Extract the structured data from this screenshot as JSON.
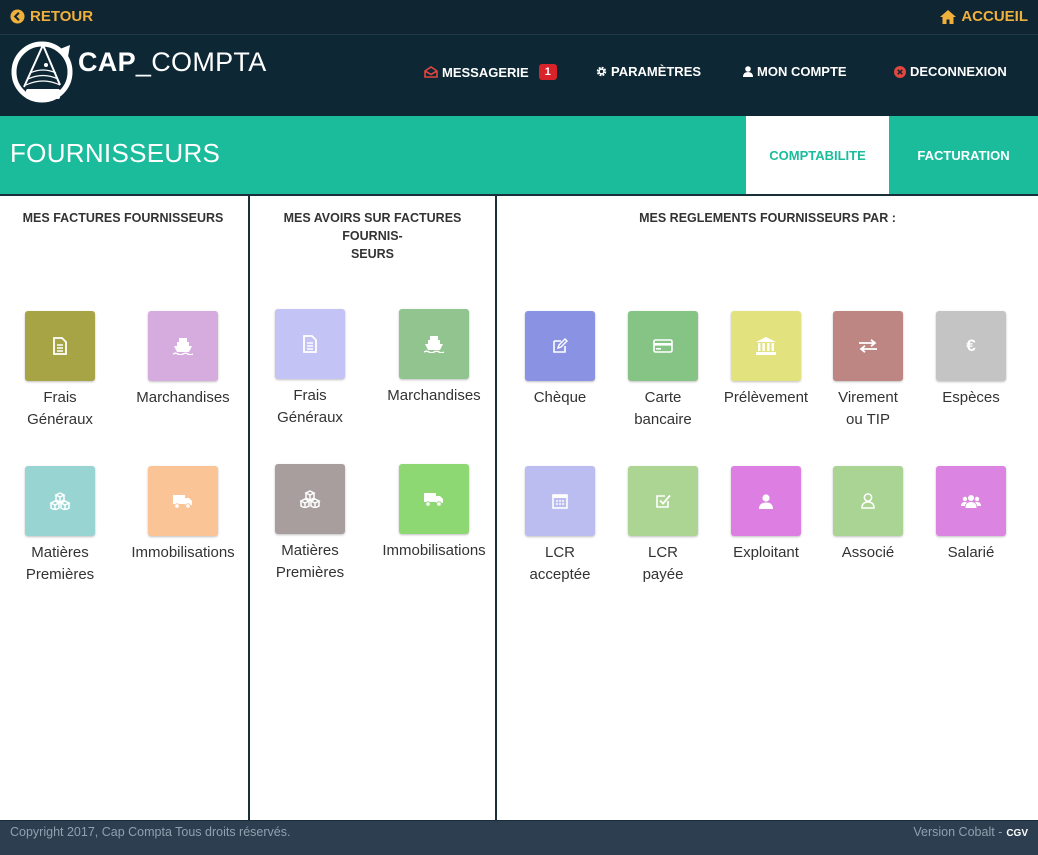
{
  "topbar": {
    "back_label": "RETOUR",
    "home_label": "ACCUEIL"
  },
  "header": {
    "brand_bold": "CAP",
    "brand_light": "_COMPTA",
    "nav": {
      "messagerie": "MESSAGERIE",
      "messagerie_count": "1",
      "parametres": "PARAMÈTRES",
      "mon_compte": "MON COMPTE",
      "deconnexion": "DECONNEXION"
    }
  },
  "band": {
    "title": "FOURNISSEURS",
    "tabs": [
      {
        "label": "COMPTABILITE"
      },
      {
        "label": "FACTURATION"
      }
    ]
  },
  "col1": {
    "title": "MES FACTURES FOURNISSEURS",
    "tiles": [
      {
        "line1": "Frais",
        "line2": "Généraux",
        "color": "#a6a444",
        "icon": "document-icon"
      },
      {
        "line1": "Marchandises",
        "line2": "",
        "color": "#d5acdd",
        "icon": "ship-icon"
      },
      {
        "line1": "Matières",
        "line2": "Premières",
        "color": "#97d4d2",
        "icon": "cubes-icon"
      },
      {
        "line1": "Immobilisations",
        "line2": "",
        "color": "#fbc497",
        "icon": "truck-icon"
      }
    ]
  },
  "col2": {
    "title_line1": "MES AVOIRS SUR FACTURES FOURNIS-",
    "title_line2": "SEURS",
    "tiles": [
      {
        "line1": "Frais",
        "line2": "Généraux",
        "color": "#c3c3f5",
        "icon": "document-icon"
      },
      {
        "line1": "Marchandises",
        "line2": "",
        "color": "#92c48f",
        "icon": "ship-icon"
      },
      {
        "line1": "Matières",
        "line2": "Premières",
        "color": "#a89e9e",
        "icon": "cubes-icon"
      },
      {
        "line1": "Immobilisations",
        "line2": "",
        "color": "#8ed874",
        "icon": "truck-icon"
      }
    ]
  },
  "col3": {
    "title": "MES REGLEMENTS FOURNISSEURS PAR :",
    "tiles": [
      {
        "line1": "Chèque",
        "line2": "",
        "color": "#8a92e3",
        "icon": "pencil-square-icon"
      },
      {
        "line1": "Carte",
        "line2": "bancaire",
        "color": "#86c486",
        "icon": "credit-card-icon"
      },
      {
        "line1": "Prélèvement",
        "line2": "",
        "color": "#e2e27e",
        "icon": "bank-icon"
      },
      {
        "line1": "Virement",
        "line2": "ou TIP",
        "color": "#bd8683",
        "icon": "exchange-icon"
      },
      {
        "line1": "Espèces",
        "line2": "",
        "color": "#c4c4c4",
        "icon": "euro-icon"
      },
      {
        "line1": "LCR",
        "line2": "acceptée",
        "color": "#bbbcef",
        "icon": "calendar-icon"
      },
      {
        "line1": "LCR",
        "line2": "payée",
        "color": "#acd594",
        "icon": "check-square-icon"
      },
      {
        "line1": "Exploitant",
        "line2": "",
        "color": "#dd7ee2",
        "icon": "user-icon"
      },
      {
        "line1": "Associé",
        "line2": "",
        "color": "#a9d493",
        "icon": "user-outline-icon"
      },
      {
        "line1": "Salarié",
        "line2": "",
        "color": "#dc84e2",
        "icon": "users-icon"
      }
    ]
  },
  "footer": {
    "copyright": "Copyright 2017, Cap Compta Tous droits réservés.",
    "version": "Version Cobalt -",
    "cgv": "CGV"
  }
}
